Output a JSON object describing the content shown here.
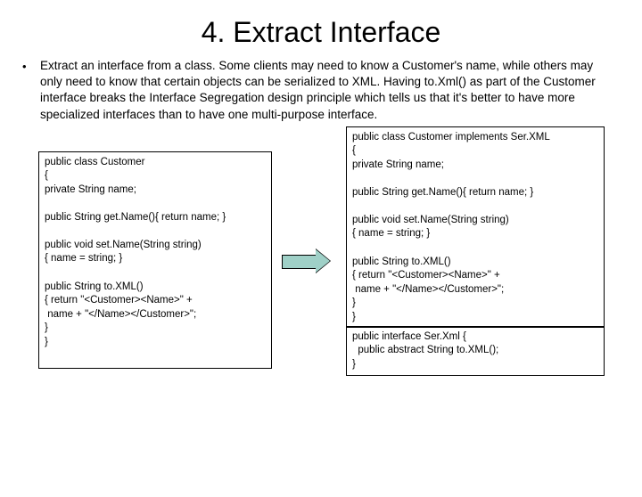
{
  "title": "4. Extract Interface",
  "bullet": "•",
  "description": "Extract an interface from a class. Some clients may need to know a Customer's name, while others may only need to know that certain objects can be serialized to XML. Having to.Xml() as part of the Customer interface breaks the Interface Segregation design principle which tells us that it's better to have more specialized interfaces than to have one multi-purpose interface.",
  "left_code": "public class Customer\n{\nprivate String name;\n\npublic String get.Name(){ return name; }\n\npublic void set.Name(String string)\n{ name = string; }\n\npublic String to.XML()\n{ return \"<Customer><Name>\" +\n name + \"</Name></Customer>\";\n}\n}",
  "right_code1": "public class Customer implements Ser.XML\n{\nprivate String name;\n\npublic String get.Name(){ return name; }\n\npublic void set.Name(String string)\n{ name = string; }\n\npublic String to.XML()\n{ return \"<Customer><Name>\" +\n name + \"</Name></Customer>\";\n}\n}",
  "right_code2": "public interface Ser.Xml {\n  public abstract String to.XML();\n}"
}
